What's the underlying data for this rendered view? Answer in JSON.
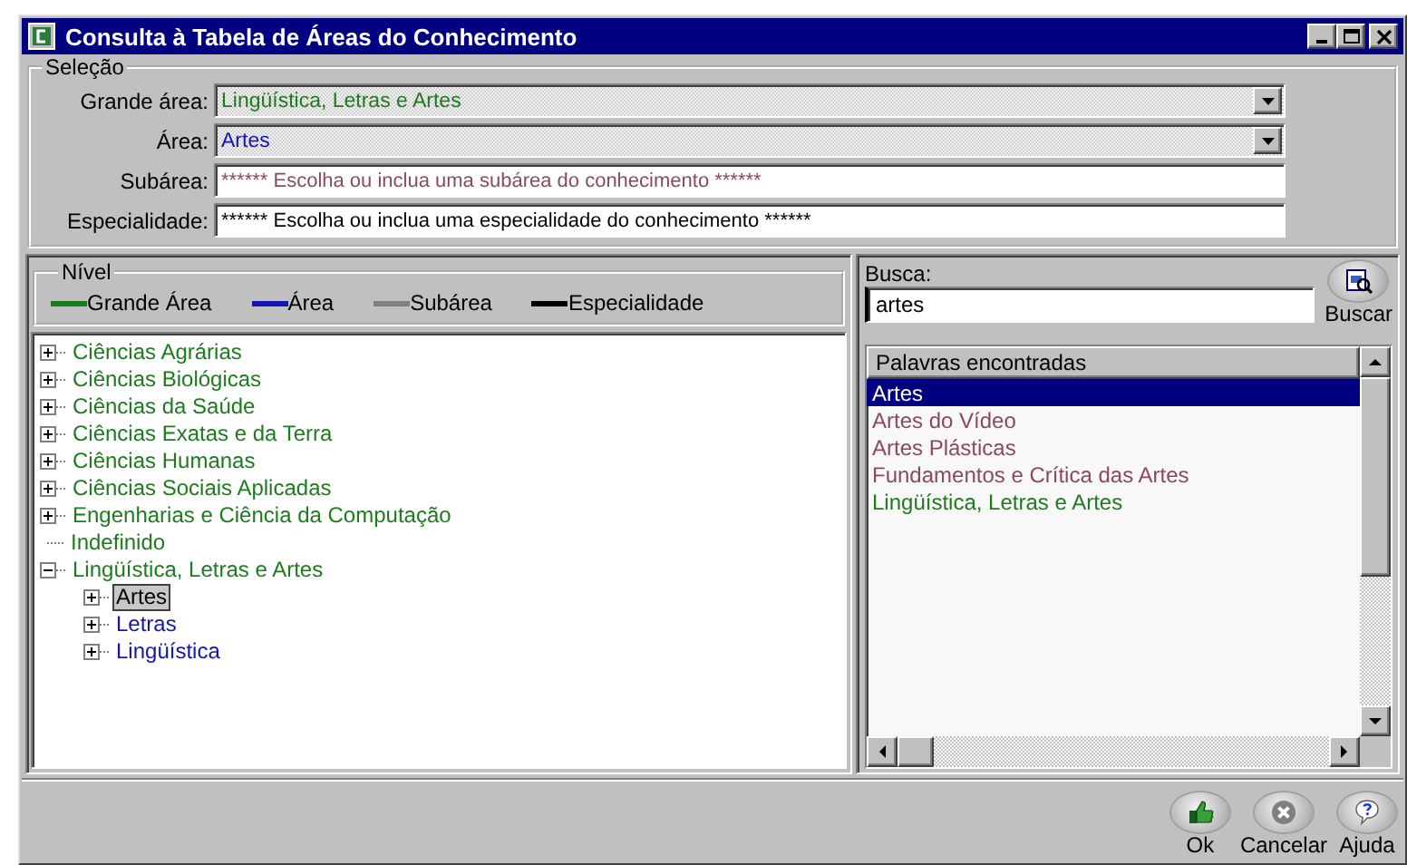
{
  "window": {
    "title": "Consulta à Tabela de Áreas do Conhecimento"
  },
  "selecao": {
    "title": "Seleção",
    "fields": [
      {
        "label": "Grande área:",
        "kind": "combo",
        "value": "Lingüística, Letras e Artes",
        "color": "#1e7b1e"
      },
      {
        "label": "Área:",
        "kind": "combo",
        "value": "Artes",
        "color": "#1414b4"
      },
      {
        "label": "Subárea:",
        "kind": "text",
        "value": "****** Escolha ou inclua uma subárea do conhecimento ******",
        "color": "#8a4a5c"
      },
      {
        "label": "Especialidade:",
        "kind": "text",
        "value": "****** Escolha ou inclua uma especialidade do conhecimento ******",
        "color": "#000000"
      }
    ]
  },
  "nivel": {
    "title": "Nível",
    "legend": [
      {
        "label": "Grande Área",
        "color": "#1e7b1e"
      },
      {
        "label": "Área",
        "color": "#1414b4"
      },
      {
        "label": "Subárea",
        "color": "#808080"
      },
      {
        "label": "Especialidade",
        "color": "#000000"
      }
    ]
  },
  "tree": [
    {
      "label": "Ciências Agrárias",
      "kind": "branch",
      "expanded": false,
      "selected": false,
      "color": "#1e7b1e"
    },
    {
      "label": "Ciências Biológicas",
      "kind": "branch",
      "expanded": false,
      "selected": false,
      "color": "#1e7b1e"
    },
    {
      "label": "Ciências da Saúde",
      "kind": "branch",
      "expanded": false,
      "selected": false,
      "color": "#1e7b1e"
    },
    {
      "label": "Ciências Exatas e da Terra",
      "kind": "branch",
      "expanded": false,
      "selected": false,
      "color": "#1e7b1e"
    },
    {
      "label": "Ciências Humanas",
      "kind": "branch",
      "expanded": false,
      "selected": false,
      "color": "#1e7b1e"
    },
    {
      "label": "Ciências Sociais Aplicadas",
      "kind": "branch",
      "expanded": false,
      "selected": false,
      "color": "#1e7b1e"
    },
    {
      "label": "Engenharias e Ciência da Computação",
      "kind": "branch",
      "expanded": false,
      "selected": false,
      "color": "#1e7b1e"
    },
    {
      "label": "Indefinido",
      "kind": "leaf",
      "selected": false,
      "color": "#1e7b1e"
    },
    {
      "label": "Lingüística, Letras e Artes",
      "kind": "branch",
      "expanded": true,
      "selected": false,
      "color": "#1e7b1e",
      "children": [
        {
          "label": "Artes",
          "kind": "branch",
          "expanded": false,
          "selected": true
        },
        {
          "label": "Letras",
          "kind": "branch",
          "expanded": false,
          "selected": false,
          "color": "#1414b4"
        },
        {
          "label": "Lingüística",
          "kind": "branch",
          "expanded": false,
          "selected": false,
          "color": "#1414b4"
        }
      ]
    }
  ],
  "busca": {
    "label": "Busca:",
    "value": "artes",
    "button": "Buscar"
  },
  "results": {
    "header": "Palavras encontradas",
    "items": [
      {
        "label": "Artes",
        "selected": true
      },
      {
        "label": "Artes do Vídeo",
        "selected": false,
        "color": "#8a4a5c"
      },
      {
        "label": "Artes Plásticas",
        "selected": false,
        "color": "#8a4a5c"
      },
      {
        "label": "Fundamentos e Crítica das Artes",
        "selected": false,
        "color": "#8a4a5c"
      },
      {
        "label": "Lingüística, Letras e Artes",
        "selected": false,
        "color": "#1e7b1e"
      }
    ]
  },
  "buttons": [
    {
      "label": "Ok",
      "kind": "ok"
    },
    {
      "label": "Cancelar",
      "kind": "cancel"
    },
    {
      "label": "Ajuda",
      "kind": "help"
    }
  ]
}
